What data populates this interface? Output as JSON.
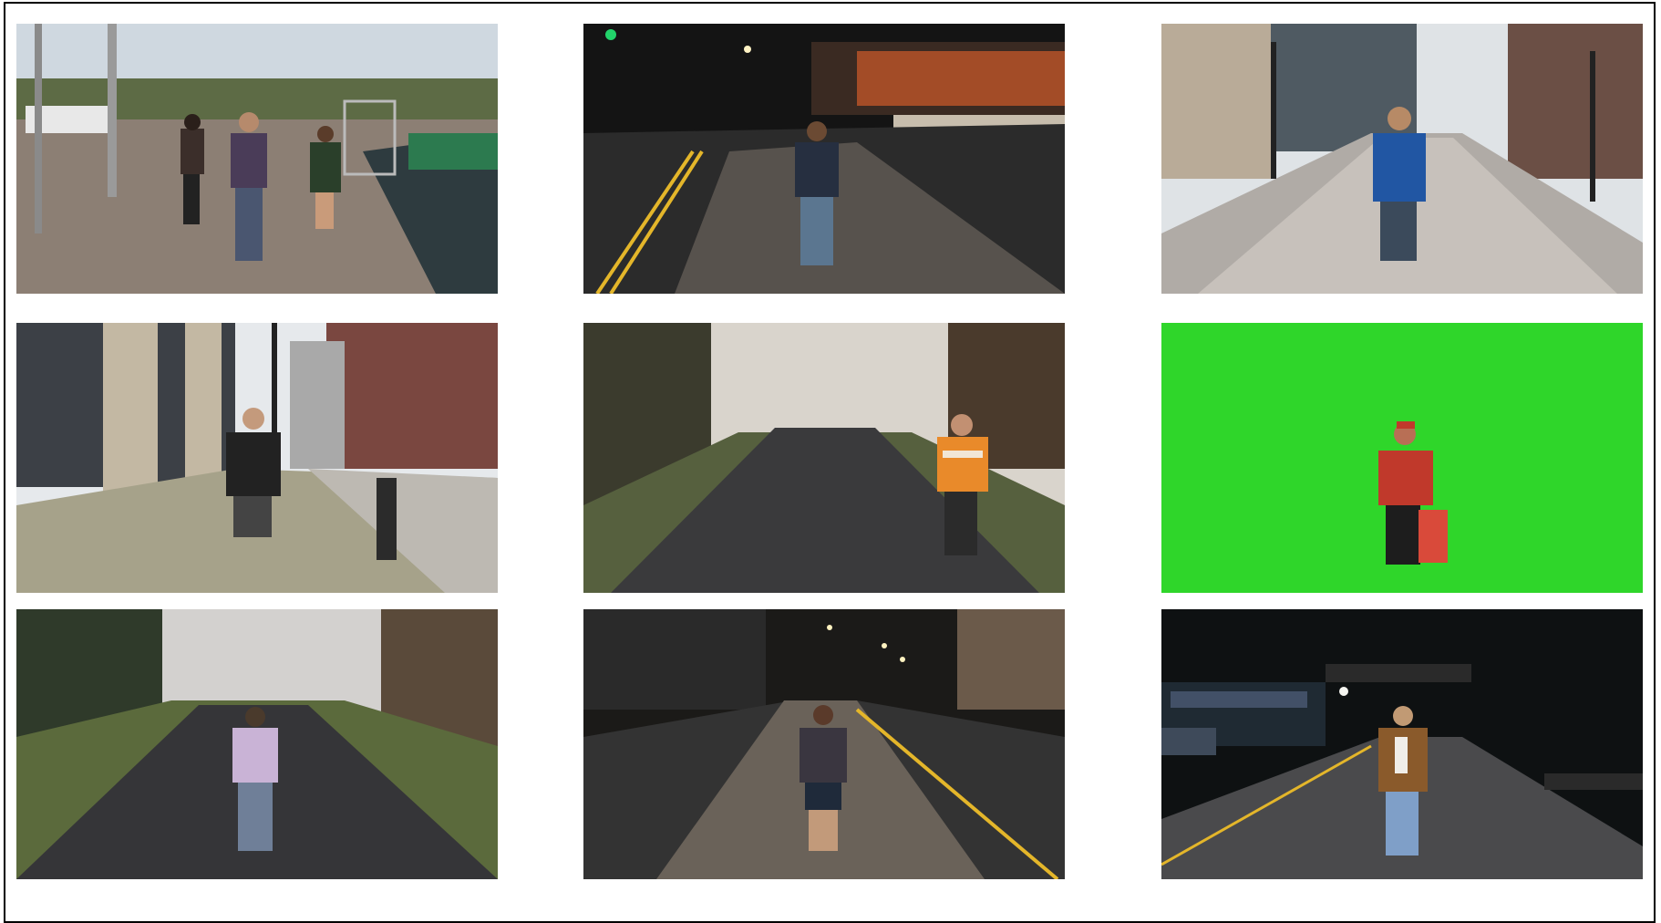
{
  "grid": {
    "columns": 3,
    "rows": 3,
    "tiles": [
      {
        "scene": "waterfront-promenade-day",
        "sky": "#cfd8e0",
        "ground": "#8c7f74",
        "figure_top": "#4a3c58",
        "figure_bottom": "#4a5670"
      },
      {
        "scene": "night-street-orange-glow",
        "sky": "#141414",
        "ground": "#57524d",
        "figure_top": "#262f40",
        "figure_bottom": "#5b7690"
      },
      {
        "scene": "city-street-paved-day",
        "sky": "#dfe3e6",
        "ground": "#b0aba6",
        "figure_top": "#2156a3",
        "figure_bottom": "#3b4a5b"
      },
      {
        "scene": "office-sidewalk-day",
        "sky": "#e6e9ec",
        "ground": "#a6a28a",
        "figure_top": "#222222",
        "figure_bottom": "#444444"
      },
      {
        "scene": "misty-country-road",
        "sky": "#d9d4cc",
        "ground": "#3a3a3c",
        "figure_top": "#e98a2a",
        "figure_bottom": "#2b2b2b"
      },
      {
        "scene": "green-screen",
        "sky": "#2fd62a",
        "ground": "#2fd62a",
        "figure_top": "#c0392b",
        "figure_bottom": "#1d1d1d"
      },
      {
        "scene": "misty-country-road-wide",
        "sky": "#d3d1cf",
        "ground": "#353538",
        "figure_top": "#c9b3d6",
        "figure_bottom": "#6f7f98"
      },
      {
        "scene": "night-street-streetlights",
        "sky": "#1b1a18",
        "ground": "#6a6259",
        "figure_top": "#3a3640",
        "figure_bottom": "#1f2a3a"
      },
      {
        "scene": "night-road-underpass",
        "sky": "#0e1112",
        "ground": "#4a4a4c",
        "figure_top": "#8a5a2b",
        "figure_bottom": "#7f9fc8"
      }
    ]
  }
}
